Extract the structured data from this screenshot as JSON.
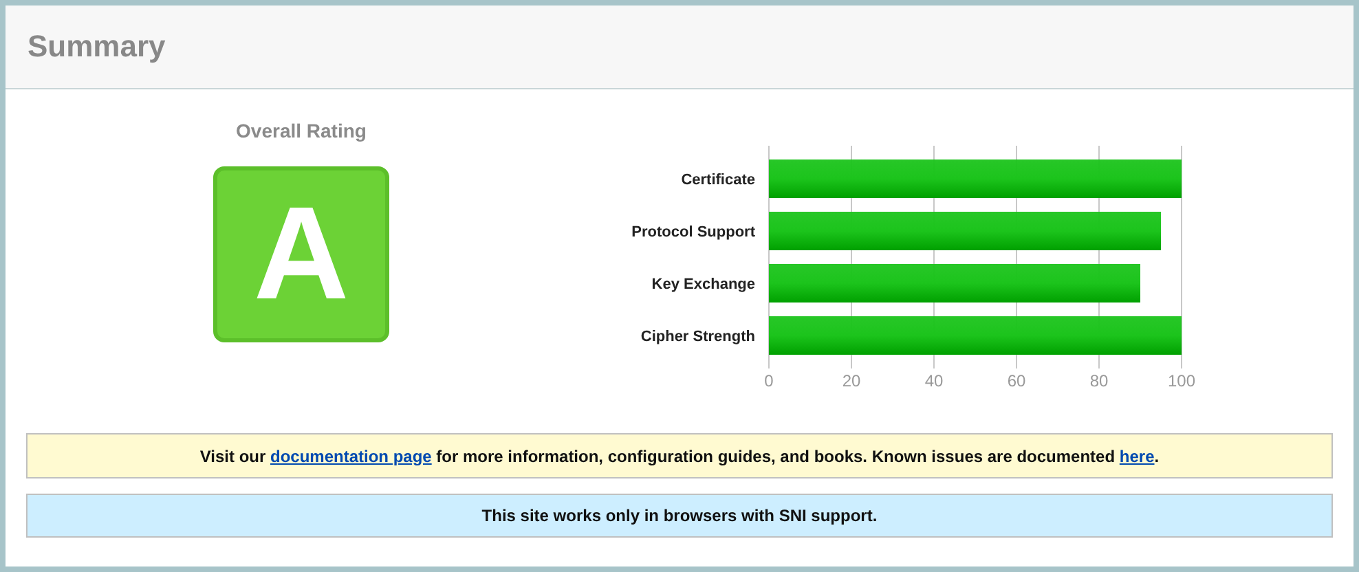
{
  "header": {
    "title": "Summary"
  },
  "rating": {
    "label": "Overall Rating",
    "grade": "A",
    "color": "#6cd236"
  },
  "chart_data": {
    "type": "bar",
    "orientation": "horizontal",
    "categories": [
      "Certificate",
      "Protocol Support",
      "Key Exchange",
      "Cipher Strength"
    ],
    "series": [
      {
        "color": "#1cc41c",
        "values": [
          100,
          95,
          90,
          100
        ]
      }
    ],
    "xlim": [
      0,
      100
    ],
    "xticks": [
      0,
      20,
      40,
      60,
      80,
      100
    ],
    "grid": true
  },
  "notices": [
    {
      "kind": "info",
      "parts": [
        {
          "kind": "text",
          "text": "Visit our "
        },
        {
          "kind": "link",
          "text": "documentation page"
        },
        {
          "kind": "text",
          "text": " for more information, configuration guides, and books. Known issues are documented "
        },
        {
          "kind": "link",
          "text": "here"
        },
        {
          "kind": "text",
          "text": "."
        }
      ]
    },
    {
      "kind": "note",
      "parts": [
        {
          "kind": "text",
          "text": "This site works only in browsers with SNI support."
        }
      ]
    }
  ]
}
